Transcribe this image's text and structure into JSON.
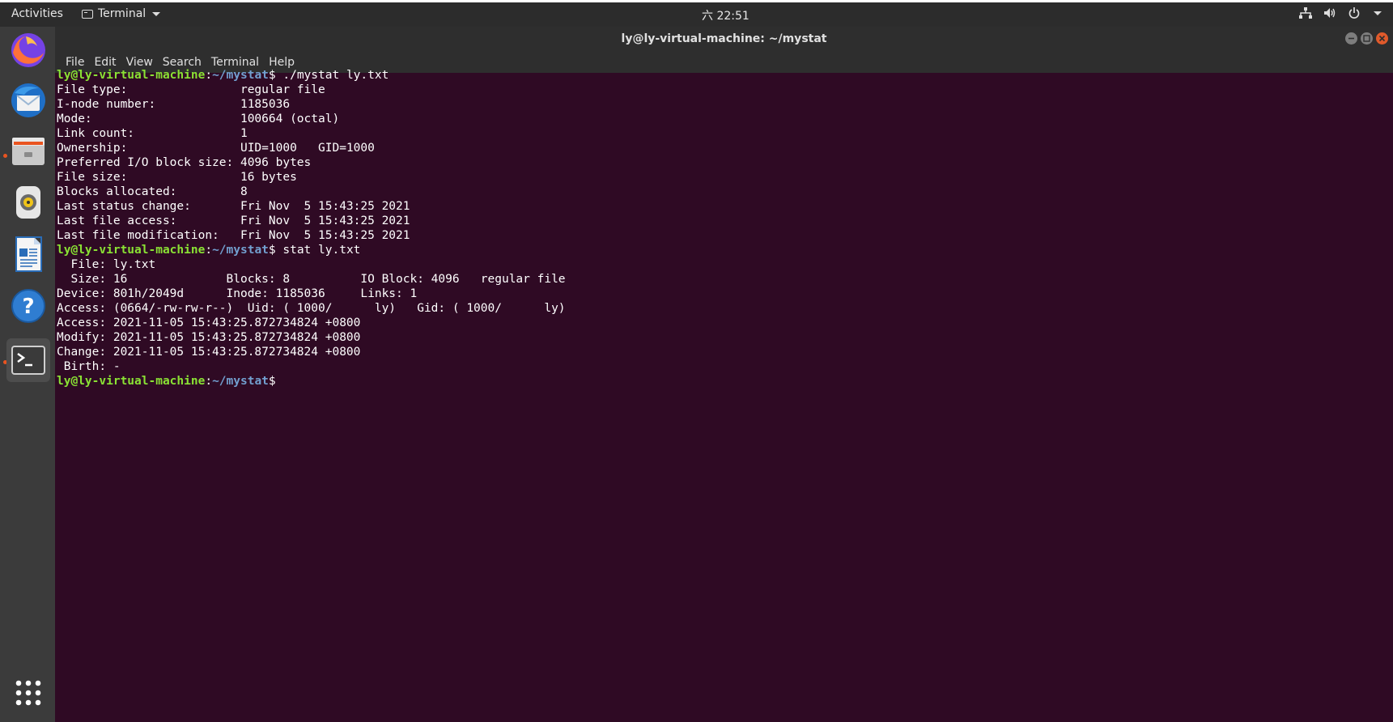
{
  "topbar": {
    "activities": "Activities",
    "app_name": "Terminal",
    "clock": "六 22:51"
  },
  "window": {
    "title": "ly@ly-virtual-machine: ~/mystat"
  },
  "menubar": {
    "items": [
      "File",
      "Edit",
      "View",
      "Search",
      "Terminal",
      "Help"
    ]
  },
  "dock": {
    "items": [
      "firefox-icon",
      "thunderbird-icon",
      "files-icon",
      "rhythmbox-icon",
      "writer-icon",
      "help-icon",
      "terminal-icon"
    ],
    "show_apps": "show-applications-icon"
  },
  "terminal": {
    "prompt_user": "ly@ly-virtual-machine",
    "prompt_path": "~/mystat",
    "lines": [
      {
        "type": "prompt",
        "cmd": " ./mystat ly.txt"
      },
      {
        "type": "out",
        "text": "File type:                regular file"
      },
      {
        "type": "out",
        "text": "I-node number:            1185036"
      },
      {
        "type": "out",
        "text": "Mode:                     100664 (octal)"
      },
      {
        "type": "out",
        "text": "Link count:               1"
      },
      {
        "type": "out",
        "text": "Ownership:                UID=1000   GID=1000"
      },
      {
        "type": "out",
        "text": "Preferred I/O block size: 4096 bytes"
      },
      {
        "type": "out",
        "text": "File size:                16 bytes"
      },
      {
        "type": "out",
        "text": "Blocks allocated:         8"
      },
      {
        "type": "out",
        "text": "Last status change:       Fri Nov  5 15:43:25 2021"
      },
      {
        "type": "out",
        "text": "Last file access:         Fri Nov  5 15:43:25 2021"
      },
      {
        "type": "out",
        "text": "Last file modification:   Fri Nov  5 15:43:25 2021"
      },
      {
        "type": "prompt",
        "cmd": " stat ly.txt"
      },
      {
        "type": "out",
        "text": "  File: ly.txt"
      },
      {
        "type": "out",
        "text": "  Size: 16              Blocks: 8          IO Block: 4096   regular file"
      },
      {
        "type": "out",
        "text": "Device: 801h/2049d      Inode: 1185036     Links: 1"
      },
      {
        "type": "out",
        "text": "Access: (0664/-rw-rw-r--)  Uid: ( 1000/      ly)   Gid: ( 1000/      ly)"
      },
      {
        "type": "out",
        "text": "Access: 2021-11-05 15:43:25.872734824 +0800"
      },
      {
        "type": "out",
        "text": "Modify: 2021-11-05 15:43:25.872734824 +0800"
      },
      {
        "type": "out",
        "text": "Change: 2021-11-05 15:43:25.872734824 +0800"
      },
      {
        "type": "out",
        "text": " Birth: -"
      },
      {
        "type": "prompt",
        "cmd": ""
      }
    ]
  },
  "colors": {
    "terminal_bg": "#2f0a24",
    "prompt_user": "#8ae234",
    "prompt_path": "#729fcf",
    "topbar_bg": "#2c2c2c",
    "dock_bg": "#3b3b3b"
  }
}
